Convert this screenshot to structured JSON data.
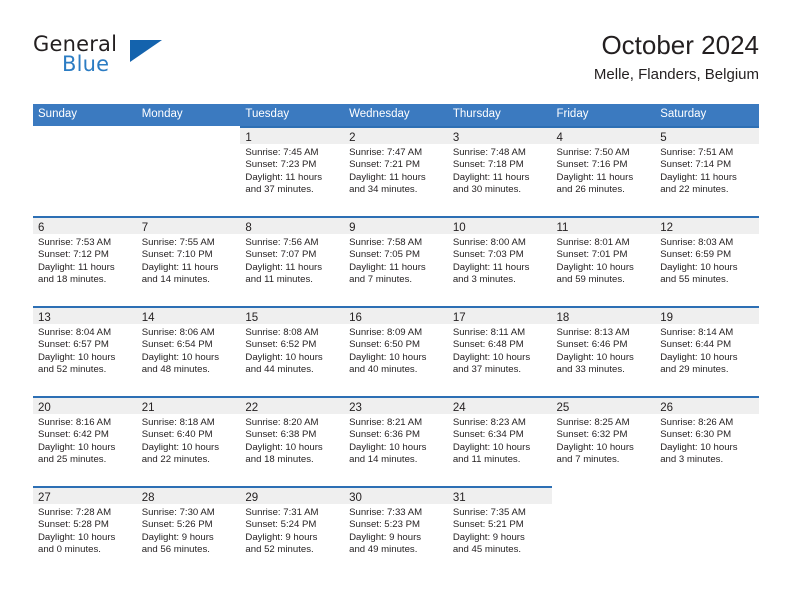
{
  "brand": {
    "name_top": "General",
    "name_bottom": "Blue",
    "triangle_color": "#1463ad",
    "blue_text_color": "#2b7cc3"
  },
  "header": {
    "title": "October 2024",
    "location": "Melle, Flanders, Belgium"
  },
  "theme": {
    "header_bar_color": "#3b7ac0",
    "date_band_color": "#efefef",
    "rule_color": "#2d6fb4",
    "text_color": "#231f20"
  },
  "weekday_headers": [
    "Sunday",
    "Monday",
    "Tuesday",
    "Wednesday",
    "Thursday",
    "Friday",
    "Saturday"
  ],
  "labels": {
    "sunrise_prefix": "Sunrise:",
    "sunset_prefix": "Sunset:",
    "daylight_prefix": "Daylight:"
  },
  "weeks": [
    [
      {
        "day": ""
      },
      {
        "day": ""
      },
      {
        "day": "1",
        "sunrise": "Sunrise: 7:45 AM",
        "sunset": "Sunset: 7:23 PM",
        "daylight_line1": "Daylight: 11 hours",
        "daylight_line2": "and 37 minutes."
      },
      {
        "day": "2",
        "sunrise": "Sunrise: 7:47 AM",
        "sunset": "Sunset: 7:21 PM",
        "daylight_line1": "Daylight: 11 hours",
        "daylight_line2": "and 34 minutes."
      },
      {
        "day": "3",
        "sunrise": "Sunrise: 7:48 AM",
        "sunset": "Sunset: 7:18 PM",
        "daylight_line1": "Daylight: 11 hours",
        "daylight_line2": "and 30 minutes."
      },
      {
        "day": "4",
        "sunrise": "Sunrise: 7:50 AM",
        "sunset": "Sunset: 7:16 PM",
        "daylight_line1": "Daylight: 11 hours",
        "daylight_line2": "and 26 minutes."
      },
      {
        "day": "5",
        "sunrise": "Sunrise: 7:51 AM",
        "sunset": "Sunset: 7:14 PM",
        "daylight_line1": "Daylight: 11 hours",
        "daylight_line2": "and 22 minutes."
      }
    ],
    [
      {
        "day": "6",
        "sunrise": "Sunrise: 7:53 AM",
        "sunset": "Sunset: 7:12 PM",
        "daylight_line1": "Daylight: 11 hours",
        "daylight_line2": "and 18 minutes."
      },
      {
        "day": "7",
        "sunrise": "Sunrise: 7:55 AM",
        "sunset": "Sunset: 7:10 PM",
        "daylight_line1": "Daylight: 11 hours",
        "daylight_line2": "and 14 minutes."
      },
      {
        "day": "8",
        "sunrise": "Sunrise: 7:56 AM",
        "sunset": "Sunset: 7:07 PM",
        "daylight_line1": "Daylight: 11 hours",
        "daylight_line2": "and 11 minutes."
      },
      {
        "day": "9",
        "sunrise": "Sunrise: 7:58 AM",
        "sunset": "Sunset: 7:05 PM",
        "daylight_line1": "Daylight: 11 hours",
        "daylight_line2": "and 7 minutes."
      },
      {
        "day": "10",
        "sunrise": "Sunrise: 8:00 AM",
        "sunset": "Sunset: 7:03 PM",
        "daylight_line1": "Daylight: 11 hours",
        "daylight_line2": "and 3 minutes."
      },
      {
        "day": "11",
        "sunrise": "Sunrise: 8:01 AM",
        "sunset": "Sunset: 7:01 PM",
        "daylight_line1": "Daylight: 10 hours",
        "daylight_line2": "and 59 minutes."
      },
      {
        "day": "12",
        "sunrise": "Sunrise: 8:03 AM",
        "sunset": "Sunset: 6:59 PM",
        "daylight_line1": "Daylight: 10 hours",
        "daylight_line2": "and 55 minutes."
      }
    ],
    [
      {
        "day": "13",
        "sunrise": "Sunrise: 8:04 AM",
        "sunset": "Sunset: 6:57 PM",
        "daylight_line1": "Daylight: 10 hours",
        "daylight_line2": "and 52 minutes."
      },
      {
        "day": "14",
        "sunrise": "Sunrise: 8:06 AM",
        "sunset": "Sunset: 6:54 PM",
        "daylight_line1": "Daylight: 10 hours",
        "daylight_line2": "and 48 minutes."
      },
      {
        "day": "15",
        "sunrise": "Sunrise: 8:08 AM",
        "sunset": "Sunset: 6:52 PM",
        "daylight_line1": "Daylight: 10 hours",
        "daylight_line2": "and 44 minutes."
      },
      {
        "day": "16",
        "sunrise": "Sunrise: 8:09 AM",
        "sunset": "Sunset: 6:50 PM",
        "daylight_line1": "Daylight: 10 hours",
        "daylight_line2": "and 40 minutes."
      },
      {
        "day": "17",
        "sunrise": "Sunrise: 8:11 AM",
        "sunset": "Sunset: 6:48 PM",
        "daylight_line1": "Daylight: 10 hours",
        "daylight_line2": "and 37 minutes."
      },
      {
        "day": "18",
        "sunrise": "Sunrise: 8:13 AM",
        "sunset": "Sunset: 6:46 PM",
        "daylight_line1": "Daylight: 10 hours",
        "daylight_line2": "and 33 minutes."
      },
      {
        "day": "19",
        "sunrise": "Sunrise: 8:14 AM",
        "sunset": "Sunset: 6:44 PM",
        "daylight_line1": "Daylight: 10 hours",
        "daylight_line2": "and 29 minutes."
      }
    ],
    [
      {
        "day": "20",
        "sunrise": "Sunrise: 8:16 AM",
        "sunset": "Sunset: 6:42 PM",
        "daylight_line1": "Daylight: 10 hours",
        "daylight_line2": "and 25 minutes."
      },
      {
        "day": "21",
        "sunrise": "Sunrise: 8:18 AM",
        "sunset": "Sunset: 6:40 PM",
        "daylight_line1": "Daylight: 10 hours",
        "daylight_line2": "and 22 minutes."
      },
      {
        "day": "22",
        "sunrise": "Sunrise: 8:20 AM",
        "sunset": "Sunset: 6:38 PM",
        "daylight_line1": "Daylight: 10 hours",
        "daylight_line2": "and 18 minutes."
      },
      {
        "day": "23",
        "sunrise": "Sunrise: 8:21 AM",
        "sunset": "Sunset: 6:36 PM",
        "daylight_line1": "Daylight: 10 hours",
        "daylight_line2": "and 14 minutes."
      },
      {
        "day": "24",
        "sunrise": "Sunrise: 8:23 AM",
        "sunset": "Sunset: 6:34 PM",
        "daylight_line1": "Daylight: 10 hours",
        "daylight_line2": "and 11 minutes."
      },
      {
        "day": "25",
        "sunrise": "Sunrise: 8:25 AM",
        "sunset": "Sunset: 6:32 PM",
        "daylight_line1": "Daylight: 10 hours",
        "daylight_line2": "and 7 minutes."
      },
      {
        "day": "26",
        "sunrise": "Sunrise: 8:26 AM",
        "sunset": "Sunset: 6:30 PM",
        "daylight_line1": "Daylight: 10 hours",
        "daylight_line2": "and 3 minutes."
      }
    ],
    [
      {
        "day": "27",
        "sunrise": "Sunrise: 7:28 AM",
        "sunset": "Sunset: 5:28 PM",
        "daylight_line1": "Daylight: 10 hours",
        "daylight_line2": "and 0 minutes."
      },
      {
        "day": "28",
        "sunrise": "Sunrise: 7:30 AM",
        "sunset": "Sunset: 5:26 PM",
        "daylight_line1": "Daylight: 9 hours",
        "daylight_line2": "and 56 minutes."
      },
      {
        "day": "29",
        "sunrise": "Sunrise: 7:31 AM",
        "sunset": "Sunset: 5:24 PM",
        "daylight_line1": "Daylight: 9 hours",
        "daylight_line2": "and 52 minutes."
      },
      {
        "day": "30",
        "sunrise": "Sunrise: 7:33 AM",
        "sunset": "Sunset: 5:23 PM",
        "daylight_line1": "Daylight: 9 hours",
        "daylight_line2": "and 49 minutes."
      },
      {
        "day": "31",
        "sunrise": "Sunrise: 7:35 AM",
        "sunset": "Sunset: 5:21 PM",
        "daylight_line1": "Daylight: 9 hours",
        "daylight_line2": "and 45 minutes."
      },
      {
        "day": ""
      },
      {
        "day": ""
      }
    ]
  ]
}
